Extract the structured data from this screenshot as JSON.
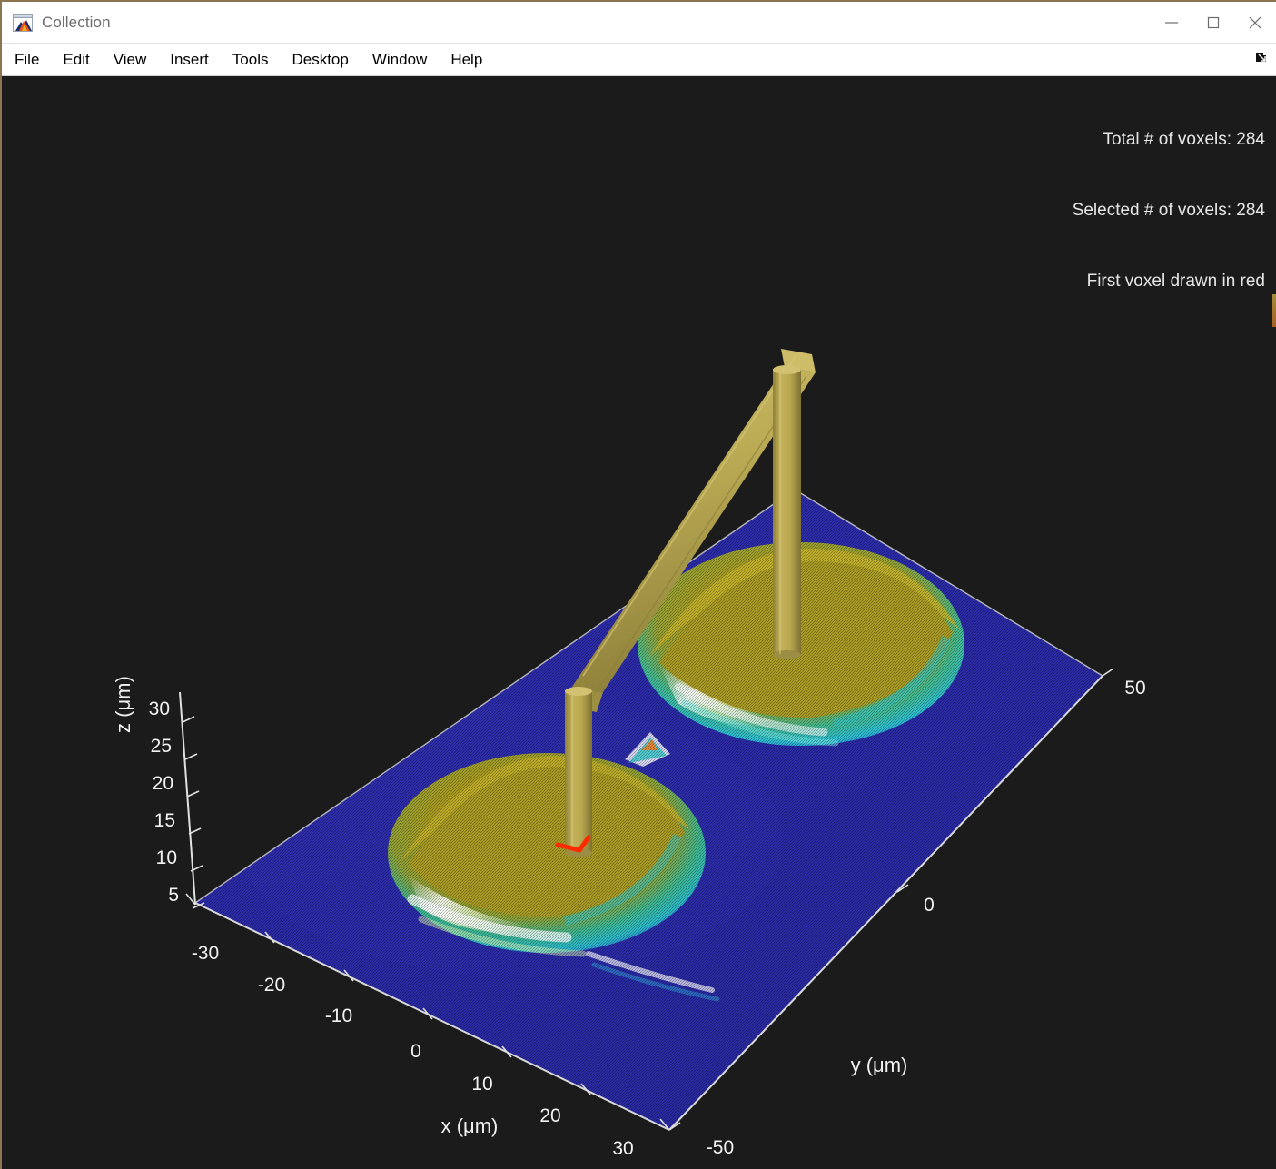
{
  "window": {
    "title": "Collection",
    "icon": "matlab-membrane-icon",
    "controls": [
      {
        "name": "minimize-button",
        "glyph": "minimize-icon"
      },
      {
        "name": "maximize-button",
        "glyph": "maximize-icon"
      },
      {
        "name": "close-button",
        "glyph": "close-icon"
      }
    ]
  },
  "menubar": {
    "items": [
      {
        "label": "File"
      },
      {
        "label": "Edit"
      },
      {
        "label": "View"
      },
      {
        "label": "Insert"
      },
      {
        "label": "Tools"
      },
      {
        "label": "Desktop"
      },
      {
        "label": "Window"
      },
      {
        "label": "Help"
      }
    ],
    "right_icon": "show-plot-tools-arrow-icon"
  },
  "figure": {
    "background_color": "#1b1b1b",
    "status_lines": [
      "Total # of voxels: 284",
      "Selected # of voxels: 284",
      "First voxel drawn in red"
    ],
    "status_line_1": "Total # of voxels: 284",
    "status_line_2": "Selected # of voxels: 284",
    "status_line_3": "First voxel drawn in red"
  },
  "chart_data": {
    "type": "surface-3d",
    "title": "",
    "xlabel": "x (μm)",
    "ylabel": "y (μm)",
    "zlabel": "z (μm)",
    "xlim": [
      -35,
      35
    ],
    "ylim": [
      -55,
      55
    ],
    "zlim": [
      0,
      33
    ],
    "x_ticks": [
      "-30",
      "-20",
      "-10",
      "0",
      "10",
      "20",
      "30"
    ],
    "x_tick_values": [
      -30,
      -20,
      -10,
      0,
      10,
      20,
      30
    ],
    "y_ticks": [
      "-50",
      "0",
      "50"
    ],
    "y_tick_values": [
      -50,
      0,
      50
    ],
    "z_ticks": [
      "5",
      "10",
      "15",
      "20",
      "25",
      "30"
    ],
    "z_tick_values": [
      5,
      10,
      15,
      20,
      25,
      30
    ],
    "grid": false,
    "legend": "none",
    "colormap": "jet",
    "axis_color": "#f2f2f2",
    "surface_base_color": "#2d2da8",
    "surface_peak_color": "#b8a200",
    "probe_color": "#b9a84f",
    "marker_color": "#ff2a00",
    "view_azimuth_deg": -37.5,
    "view_elevation_deg": 30,
    "annotations": [
      "Two raised mound features on a flat substrate plane",
      "Two vertical cylindrical probes joined by a horizontal crossbar",
      "First selected voxel highlighted in red at base of left probe"
    ],
    "features": [
      {
        "name": "mound-left",
        "center_x": -5,
        "center_y": -5,
        "peak_z": 14
      },
      {
        "name": "mound-right",
        "center_x": 12,
        "center_y": 30,
        "peak_z": 16
      },
      {
        "name": "probe-left",
        "base_x": -3,
        "base_y": -6,
        "top_z": 30
      },
      {
        "name": "probe-right",
        "base_x": 14,
        "base_y": 28,
        "top_z": 33
      }
    ]
  }
}
